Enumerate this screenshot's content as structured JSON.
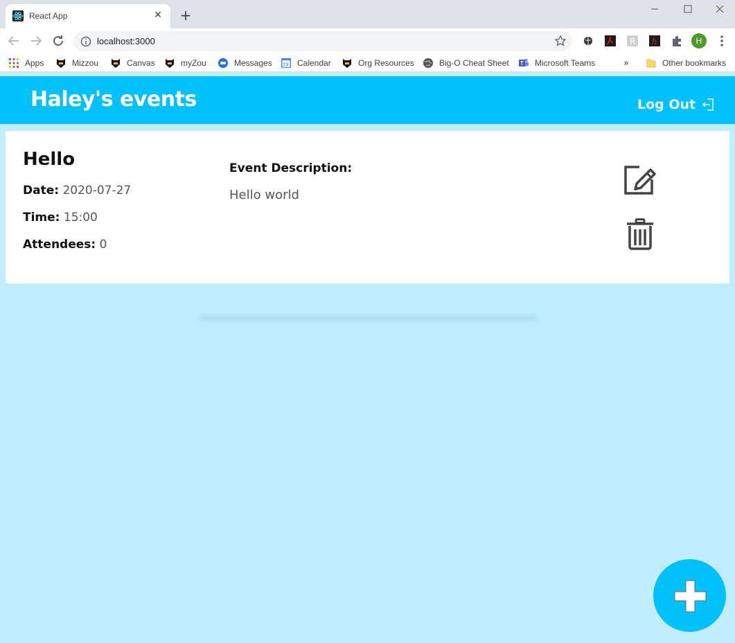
{
  "browser": {
    "tab_title": "React App",
    "url": "localhost:3000",
    "bookmarks": [
      "Apps",
      "Mizzou",
      "Canvas",
      "myZou",
      "Messages",
      "Calendar",
      "Org Resources",
      "Big-O Cheat Sheet",
      "Microsoft Teams"
    ],
    "calendar_day": "23",
    "other_bookmarks": "Other bookmarks",
    "more_bookmarks": "»",
    "profile_initial": "H"
  },
  "app": {
    "title": "Haley's events",
    "logout_label": "Log Out",
    "accent_color": "#00c1fc",
    "background_color": "#c0eefe"
  },
  "event": {
    "title": "Hello",
    "date_label": "Date:",
    "date_value": "2020-07-27",
    "time_label": "Time:",
    "time_value": "15:00",
    "attendees_label": "Attendees:",
    "attendees_value": "0",
    "description_label": "Event Description:",
    "description_value": "Hello world"
  },
  "icons": {
    "edit": "edit-icon",
    "delete": "trash-icon",
    "logout": "logout-icon",
    "add": "plus-icon"
  }
}
